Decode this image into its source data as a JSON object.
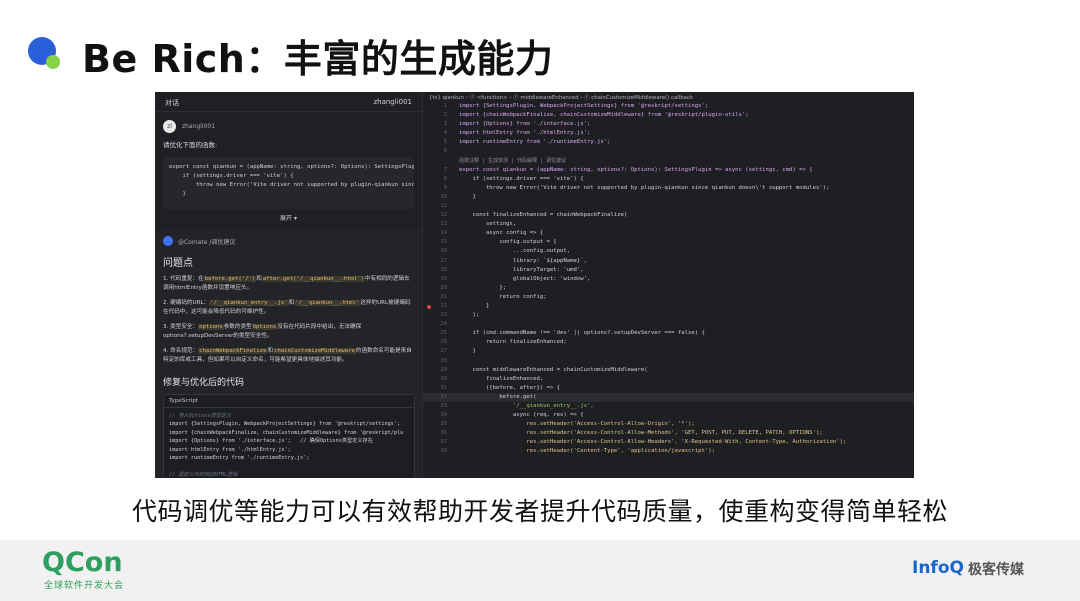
{
  "slide": {
    "title": "Be Rich：丰富的生成能力",
    "caption": "代码调优等能力可以有效帮助开发者提升代码质量，使重构变得简单轻松"
  },
  "chat": {
    "header_title": "对话",
    "header_user": "zhangli001",
    "user_name": "zhangli001",
    "avatar_text": "zl",
    "prompt": "请优化下面的函数:",
    "user_code": "export const qiankun = (appName: string, options?: Options): SettingsPlugin\n    if (settings.driver === 'vite') {\n        throw new Error('Vite driver not supported by plugin-qiankun since c\n    }",
    "expand_label": "展开 ▾",
    "ai_name": "@Comate /调优建议",
    "ai_title": "问题点",
    "issues": [
      {
        "num": "1.",
        "head": "代码重复：在",
        "c1": "before.get('/')",
        "mid": "和",
        "c2": "after.get('/__qiankun__.html')",
        "tail": "中有相同的逻辑去调用htmlEntry函数并设置响应头。"
      },
      {
        "num": "2.",
        "head": "硬编码的URL：",
        "c1": "'/__qiankun_entry__.js'",
        "mid": "和",
        "c2": "'/__qiankun__.html'",
        "tail": "这样的URL被硬编码在代码中，这可能会降低代码的可维护性。"
      },
      {
        "num": "3.",
        "head": "类型安全：",
        "c1": "options",
        "mid": "参数的类型",
        "c2": "Options",
        "tail": "没有在代码片段中给出，无法确保options?.setupDevServer的类型安全性。"
      },
      {
        "num": "4.",
        "head": "命名规范：",
        "c1": "chainWebpackFinalize",
        "mid": "和",
        "c2": "chainCustomizeMiddleware",
        "tail": "的函数命名可能是来自特定的库或工具，但如果可以自定义命名，可能希望更具体地描述其功能。"
      }
    ],
    "fix_title": "修复与优化后的代码",
    "ts_label": "TypeScript",
    "ts_lines": [
      "// 导入Options类型定义",
      "import {SettingsPlugin, WebpackProjectSettings} from '@reskript/settings';",
      "import {chainWebpackFinalize, chainCustomizeMiddleware} from '@reskript/plu",
      "import {Options} from './interface.js';   // 确保Options类型定义存在",
      "import htmlEntry from './htmlEntry.js';",
      "import runtimeEntry from './runtimeEntry.js';",
      "",
      "// 提取公共的响应HTML逻辑"
    ]
  },
  "editor": {
    "breadcrumb": "{ts} qiankun › ⓕ <function> › ⓕ middlewareEnhanced › ⓕ chainCustomizeMiddleware() callback",
    "hint": "函数注释 | 生成单测 | 代码解释 | 调优建议",
    "lines": [
      {
        "n": "1",
        "t": "import {SettingsPlugin, WebpackProjectSettings} from '@reskript/settings';"
      },
      {
        "n": "2",
        "t": "import {chainWebpackFinalize, chainCustomizeMiddleware} from '@reskript/plugin-utils';"
      },
      {
        "n": "3",
        "t": "import {Options} from './interface.js';"
      },
      {
        "n": "4",
        "t": "import htmlEntry from './htmlEntry.js';"
      },
      {
        "n": "5",
        "t": "import runtimeEntry from './runtimeEntry.js';"
      },
      {
        "n": "6",
        "t": ""
      },
      {
        "n": "7",
        "t": "export const qiankun = (appName: string, options?: Options): SettingsPlugin => async (settings, cmd) => {"
      },
      {
        "n": "8",
        "t": "    if (settings.driver === 'vite') {"
      },
      {
        "n": "9",
        "t": "        throw new Error('Vite driver not supported by plugin-qiankun since qiankun doesn\\'t support modules');"
      },
      {
        "n": "10",
        "t": "    }"
      },
      {
        "n": "11",
        "t": ""
      },
      {
        "n": "12",
        "t": "    const finalizeEnhanced = chainWebpackFinalize("
      },
      {
        "n": "13",
        "t": "        settings,"
      },
      {
        "n": "14",
        "t": "        async config => {"
      },
      {
        "n": "15",
        "t": "            config.output = {"
      },
      {
        "n": "16",
        "t": "                ...config.output,"
      },
      {
        "n": "17",
        "t": "                library: `${appName}`,"
      },
      {
        "n": "18",
        "t": "                libraryTarget: 'umd',"
      },
      {
        "n": "19",
        "t": "                globalObject: 'window',"
      },
      {
        "n": "20",
        "t": "            };"
      },
      {
        "n": "21",
        "t": "            return config;"
      },
      {
        "n": "22",
        "t": "        }"
      },
      {
        "n": "23",
        "t": "    );"
      },
      {
        "n": "24",
        "t": ""
      },
      {
        "n": "25",
        "t": "    if (cmd.commandName !== 'dev' || options?.setupDevServer === false) {"
      },
      {
        "n": "26",
        "t": "        return finalizeEnhanced;"
      },
      {
        "n": "27",
        "t": "    }"
      },
      {
        "n": "28",
        "t": ""
      },
      {
        "n": "29",
        "t": "    const middlewareEnhanced = chainCustomizeMiddleware("
      },
      {
        "n": "30",
        "t": "        finalizeEnhanced,"
      },
      {
        "n": "31",
        "t": "        ({before, after}) => {"
      },
      {
        "n": "32",
        "t": "            before.get("
      },
      {
        "n": "33",
        "t": "                '/__qiankun_entry__.js',"
      },
      {
        "n": "34",
        "t": "                async (req, res) => {"
      },
      {
        "n": "35",
        "t": "                    res.setHeader('Access-Control-Allow-Origin', '*');"
      },
      {
        "n": "36",
        "t": "                    res.setHeader('Access-Control-Allow-Methods', 'GET, POST, PUT, DELETE, PATCH, OPTIONS');"
      },
      {
        "n": "37",
        "t": "                    res.setHeader('Access-Control-Allow-Headers', 'X-Requested-With, Content-Type, Authorization');"
      },
      {
        "n": "38",
        "t": "                    res.setHeader('Content-Type', 'application/javascript');"
      }
    ]
  },
  "footer": {
    "qcon_logo": "QCon",
    "qcon_sub": "全球软件开发大会",
    "infoq_logo": "InfoQ",
    "infoq_cn": "极客传媒"
  }
}
